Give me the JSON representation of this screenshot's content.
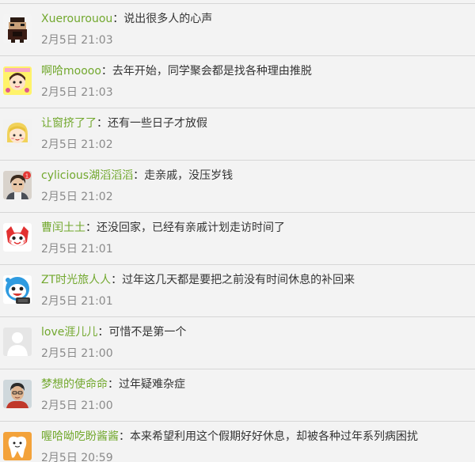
{
  "comments": [
    {
      "username": "Xuerourouou",
      "separator": "：",
      "text": "说出很多人的心声",
      "time": "2月5日 21:03",
      "avatar": "ninja-character-avatar"
    },
    {
      "username": "啊哈moooo",
      "separator": "：",
      "text": "去年开始，同学聚会都是找各种理由推脱",
      "time": "2月5日 21:03",
      "avatar": "cartoon-girl-avatar"
    },
    {
      "username": "让窗挤了了",
      "separator": "：",
      "text": "还有一些日子才放假",
      "time": "2月5日 21:02",
      "avatar": "blonde-girl-avatar"
    },
    {
      "username": "cylicious湖滔滔滔",
      "separator": "：",
      "text": "走亲戚，没压岁钱",
      "time": "2月5日 21:02",
      "avatar": "boy-photo-avatar"
    },
    {
      "username": "曹闰土土",
      "separator": "：",
      "text": "还没回家，已经有亲戚计划走访时间了",
      "time": "2月5日 21:01",
      "avatar": "red-cartoon-avatar"
    },
    {
      "username": "ZT时光旅人人",
      "separator": "：",
      "text": "过年这几天都是要把之前没有时间休息的补回来",
      "time": "2月5日 21:01",
      "avatar": "blue-cartoon-avatar"
    },
    {
      "username": "love涯儿儿",
      "separator": "：",
      "text": "可惜不是第一个",
      "time": "2月5日 21:00",
      "avatar": "default-user-avatar"
    },
    {
      "username": "梦想的使命命",
      "separator": "：",
      "text": "过年疑难杂症",
      "time": "2月5日 21:00",
      "avatar": "man-photo-avatar"
    },
    {
      "username": "喔哈呦吃盼酱酱",
      "separator": "：",
      "text": "本来希望利用这个假期好好休息，却被各种过年系列病困扰",
      "time": "2月5日 20:59",
      "avatar": "tooth-cartoon-avatar"
    }
  ],
  "colors": {
    "username": "#72a82e",
    "text": "#333333",
    "time": "#8a8a8a",
    "background": "#f3f3f3",
    "divider": "#d6d6d6"
  }
}
